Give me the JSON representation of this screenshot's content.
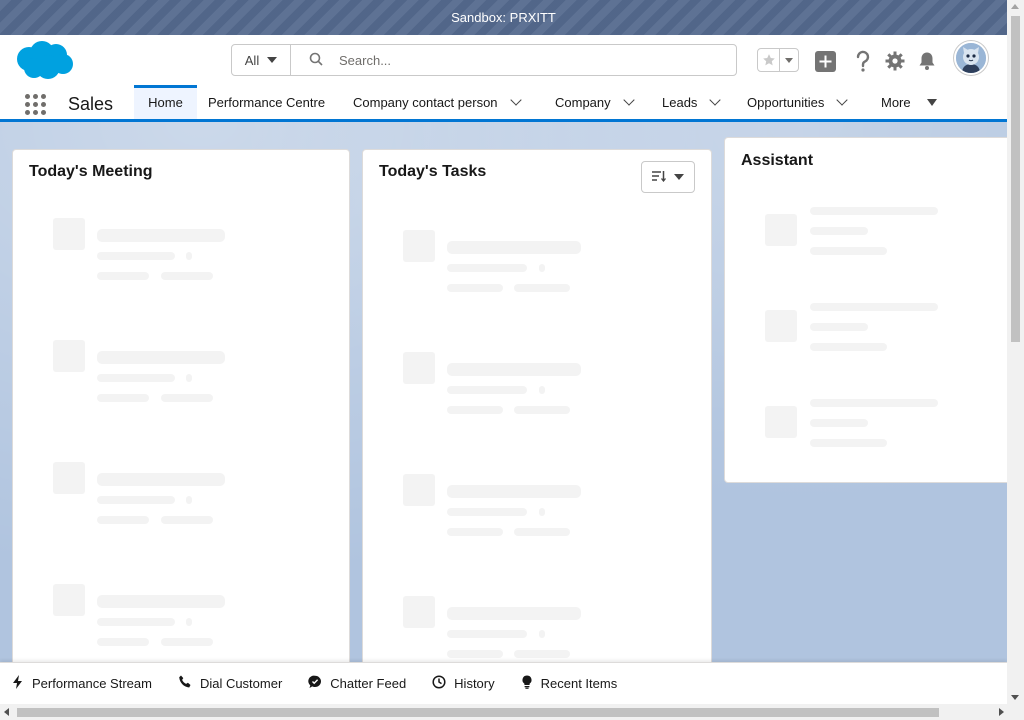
{
  "sandbox_banner": {
    "text": "Sandbox: PRXITT"
  },
  "header": {
    "search": {
      "scope": "All",
      "placeholder": "Search..."
    },
    "icons": [
      "salesforce-logo-icon",
      "favorite-star-icon",
      "add-icon",
      "help-icon",
      "setup-gear-icon",
      "notification-bell-icon",
      "user-avatar"
    ]
  },
  "nav": {
    "app_name": "Sales",
    "items": [
      {
        "label": "Home",
        "active": true
      },
      {
        "label": "Performance Centre"
      },
      {
        "label": "Company contact person"
      },
      {
        "label": "Company"
      },
      {
        "label": "Leads"
      },
      {
        "label": "Opportunities"
      },
      {
        "label": "More"
      }
    ]
  },
  "cards": {
    "meeting": {
      "title": "Today's Meeting"
    },
    "tasks": {
      "title": "Today's Tasks"
    },
    "assistant": {
      "title": "Assistant"
    }
  },
  "utility_bar": {
    "items": [
      {
        "label": "Performance Stream",
        "icon": "lightning-icon"
      },
      {
        "label": "Dial Customer",
        "icon": "phone-icon"
      },
      {
        "label": "Chatter Feed",
        "icon": "chatter-icon"
      },
      {
        "label": "History",
        "icon": "clock-icon"
      },
      {
        "label": "Recent Items",
        "icon": "lightbulb-icon"
      }
    ]
  },
  "colors": {
    "brand": "#0176d3",
    "sandbox": "#54698d",
    "background": "#b0c4df",
    "logo": "#00a1e0"
  }
}
